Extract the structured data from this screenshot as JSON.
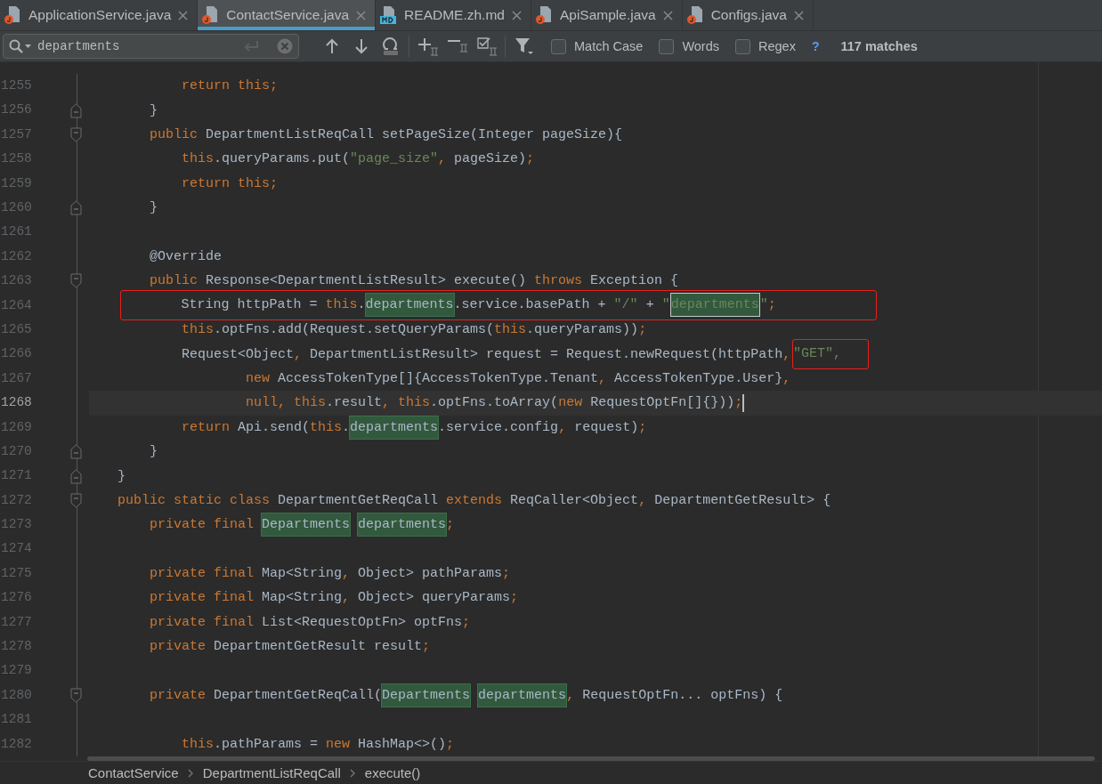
{
  "tabs": [
    {
      "label": "ApplicationService.java",
      "kind": "java",
      "selected": false
    },
    {
      "label": "ContactService.java",
      "kind": "java",
      "selected": true
    },
    {
      "label": "README.zh.md",
      "kind": "md",
      "selected": false
    },
    {
      "label": "ApiSample.java",
      "kind": "java",
      "selected": false
    },
    {
      "label": "Configs.java",
      "kind": "java",
      "selected": false
    }
  ],
  "search": {
    "value": "departments",
    "options": [
      {
        "label": "Match Case",
        "checked": false
      },
      {
        "label": "Words",
        "checked": false
      },
      {
        "label": "Regex",
        "checked": false
      }
    ],
    "help": "?",
    "matches": "117 matches"
  },
  "editor": {
    "lines": [
      {
        "number": "1255",
        "kind": "body",
        "current": false,
        "boxed": false,
        "fold_start": false,
        "fold_end": false,
        "tokens": [
          {
            "text": "return this;",
            "kind": "kw"
          }
        ]
      },
      {
        "number": "1256",
        "kind": "member",
        "current": false,
        "boxed": false,
        "fold_start": false,
        "fold_end": true,
        "tokens": [
          {
            "text": "}",
            "kind": "plain"
          }
        ]
      },
      {
        "number": "1257",
        "kind": "member",
        "current": false,
        "boxed": false,
        "fold_start": true,
        "fold_end": false,
        "tokens": [
          {
            "text": "public",
            "kind": "kw"
          },
          {
            "text": " DepartmentListReqCall setPageSize(Integer pageSize){",
            "kind": "plain"
          }
        ]
      },
      {
        "number": "1258",
        "kind": "body",
        "current": false,
        "boxed": false,
        "fold_start": false,
        "fold_end": false,
        "tokens": [
          {
            "text": "this",
            "kind": "kw"
          },
          {
            "text": ".queryParams.put(",
            "kind": "plain"
          },
          {
            "text": "\"page_size\"",
            "kind": "str"
          },
          {
            "text": ",",
            "kind": "kw"
          },
          {
            "text": " pageSize)",
            "kind": "plain"
          },
          {
            "text": ";",
            "kind": "kw"
          }
        ]
      },
      {
        "number": "1259",
        "kind": "body",
        "current": false,
        "boxed": false,
        "fold_start": false,
        "fold_end": false,
        "tokens": [
          {
            "text": "return this;",
            "kind": "kw"
          }
        ]
      },
      {
        "number": "1260",
        "kind": "member",
        "current": false,
        "boxed": false,
        "fold_start": false,
        "fold_end": true,
        "tokens": [
          {
            "text": "}",
            "kind": "plain"
          }
        ]
      },
      {
        "number": "1261",
        "kind": "member",
        "current": false,
        "boxed": false,
        "fold_start": false,
        "fold_end": false
      },
      {
        "number": "1262",
        "kind": "member",
        "current": false,
        "boxed": false,
        "fold_start": false,
        "fold_end": false,
        "tokens": [
          {
            "text": "@Override",
            "kind": "plain"
          }
        ]
      },
      {
        "number": "1263",
        "kind": "member",
        "current": false,
        "boxed": false,
        "fold_start": true,
        "fold_end": false,
        "tokens": [
          {
            "text": "public",
            "kind": "kw"
          },
          {
            "text": " Response<DepartmentListResult> execute() ",
            "kind": "plain"
          },
          {
            "text": "throws",
            "kind": "kw"
          },
          {
            "text": " Exception {",
            "kind": "plain"
          }
        ]
      },
      {
        "number": "1264",
        "kind": "body",
        "current": false,
        "boxed": true,
        "fold_start": false,
        "fold_end": false,
        "tokens": [
          {
            "text": "String httpPath = ",
            "kind": "plain"
          },
          {
            "text": "this",
            "kind": "kw"
          },
          {
            "text": ".",
            "kind": "plain"
          },
          {
            "text": "departments",
            "kind": "match"
          },
          {
            "text": ".service.basePath + ",
            "kind": "plain"
          },
          {
            "text": "\"/\"",
            "kind": "str"
          },
          {
            "text": " + ",
            "kind": "plain"
          },
          {
            "text": "\"",
            "kind": "str"
          },
          {
            "text": "departments",
            "kind": "current-match"
          },
          {
            "text": "\"",
            "kind": "str"
          },
          {
            "text": ";",
            "kind": "kw"
          }
        ]
      },
      {
        "number": "1265",
        "kind": "body",
        "current": false,
        "boxed": false,
        "fold_start": false,
        "fold_end": false,
        "tokens": [
          {
            "text": "this",
            "kind": "kw"
          },
          {
            "text": ".optFns.add(Request.setQueryParams(",
            "kind": "plain"
          },
          {
            "text": "this",
            "kind": "kw"
          },
          {
            "text": ".queryParams))",
            "kind": "plain"
          },
          {
            "text": ";",
            "kind": "kw"
          }
        ]
      },
      {
        "number": "1266",
        "kind": "body",
        "current": false,
        "boxed": false,
        "fold_start": false,
        "fold_end": false,
        "tokens": [
          {
            "text": "Request<Object",
            "kind": "plain"
          },
          {
            "text": ",",
            "kind": "kw"
          },
          {
            "text": " DepartmentListResult> request = Request.newRequest(httpPath",
            "kind": "plain"
          },
          {
            "text": ",",
            "kind": "kw"
          },
          {
            "text": "\"GET\",",
            "kind": "boxed-str"
          }
        ]
      },
      {
        "number": "1267",
        "kind": "continuation",
        "current": false,
        "boxed": false,
        "fold_start": false,
        "fold_end": false,
        "tokens": [
          {
            "text": "new",
            "kind": "kw"
          },
          {
            "text": " AccessTokenType[]{AccessTokenType.Tenant",
            "kind": "plain"
          },
          {
            "text": ",",
            "kind": "kw"
          },
          {
            "text": " AccessTokenType.User}",
            "kind": "plain"
          },
          {
            "text": ",",
            "kind": "kw"
          }
        ]
      },
      {
        "number": "1268",
        "kind": "continuation",
        "current": true,
        "boxed": false,
        "fold_start": false,
        "fold_end": false,
        "tokens": [
          {
            "text": "null,",
            "kind": "kw"
          },
          {
            "text": " this",
            "kind": "kw"
          },
          {
            "text": ".result",
            "kind": "plain"
          },
          {
            "text": ",",
            "kind": "kw"
          },
          {
            "text": " this",
            "kind": "kw"
          },
          {
            "text": ".optFns.toArray(",
            "kind": "plain"
          },
          {
            "text": "new",
            "kind": "kw"
          },
          {
            "text": " RequestOptFn[]{}))",
            "kind": "plain"
          },
          {
            "text": ";",
            "kind": "kw"
          }
        ]
      },
      {
        "number": "1269",
        "kind": "body",
        "current": false,
        "boxed": false,
        "fold_start": false,
        "fold_end": false,
        "tokens": [
          {
            "text": "return",
            "kind": "kw"
          },
          {
            "text": " Api.send(",
            "kind": "plain"
          },
          {
            "text": "this",
            "kind": "kw"
          },
          {
            "text": ".",
            "kind": "plain"
          },
          {
            "text": "departments",
            "kind": "match"
          },
          {
            "text": ".service.config",
            "kind": "plain"
          },
          {
            "text": ",",
            "kind": "kw"
          },
          {
            "text": " request)",
            "kind": "plain"
          },
          {
            "text": ";",
            "kind": "kw"
          }
        ]
      },
      {
        "number": "1270",
        "kind": "member",
        "current": false,
        "boxed": false,
        "fold_start": false,
        "fold_end": true,
        "tokens": [
          {
            "text": "}",
            "kind": "plain"
          }
        ]
      },
      {
        "number": "1271",
        "kind": "class",
        "current": false,
        "boxed": false,
        "fold_start": false,
        "fold_end": true,
        "tokens": [
          {
            "text": "}",
            "kind": "plain"
          }
        ]
      },
      {
        "number": "1272",
        "kind": "class",
        "current": false,
        "boxed": false,
        "fold_start": true,
        "fold_end": false,
        "tokens": [
          {
            "text": "public static class",
            "kind": "kw"
          },
          {
            "text": " DepartmentGetReqCall ",
            "kind": "plain"
          },
          {
            "text": "extends",
            "kind": "kw"
          },
          {
            "text": " ReqCaller<Object",
            "kind": "plain"
          },
          {
            "text": ",",
            "kind": "kw"
          },
          {
            "text": " DepartmentGetResult> {",
            "kind": "plain"
          }
        ]
      },
      {
        "number": "1273",
        "kind": "member",
        "current": false,
        "boxed": false,
        "fold_start": false,
        "fold_end": false,
        "tokens": [
          {
            "text": "private final ",
            "kind": "kw"
          },
          {
            "text": "Departments",
            "kind": "match"
          },
          {
            "text": "departments",
            "kind": "match"
          },
          {
            "text": ";",
            "kind": "kw"
          }
        ]
      },
      {
        "number": "1274",
        "kind": "member",
        "current": false,
        "boxed": false,
        "fold_start": false,
        "fold_end": false
      },
      {
        "number": "1275",
        "kind": "member",
        "current": false,
        "boxed": false,
        "fold_start": false,
        "fold_end": false,
        "tokens": [
          {
            "text": "private final",
            "kind": "kw"
          },
          {
            "text": " Map<String",
            "kind": "plain"
          },
          {
            "text": ",",
            "kind": "kw"
          },
          {
            "text": " Object> pathParams",
            "kind": "plain"
          },
          {
            "text": ";",
            "kind": "kw"
          }
        ]
      },
      {
        "number": "1276",
        "kind": "member",
        "current": false,
        "boxed": false,
        "fold_start": false,
        "fold_end": false,
        "tokens": [
          {
            "text": "private final",
            "kind": "kw"
          },
          {
            "text": " Map<String",
            "kind": "plain"
          },
          {
            "text": ",",
            "kind": "kw"
          },
          {
            "text": " Object> queryParams",
            "kind": "plain"
          },
          {
            "text": ";",
            "kind": "kw"
          }
        ]
      },
      {
        "number": "1277",
        "kind": "member",
        "current": false,
        "boxed": false,
        "fold_start": false,
        "fold_end": false,
        "tokens": [
          {
            "text": "private final",
            "kind": "kw"
          },
          {
            "text": " List<RequestOptFn> optFns",
            "kind": "plain"
          },
          {
            "text": ";",
            "kind": "kw"
          }
        ]
      },
      {
        "number": "1278",
        "kind": "member",
        "current": false,
        "boxed": false,
        "fold_start": false,
        "fold_end": false,
        "tokens": [
          {
            "text": "private",
            "kind": "kw"
          },
          {
            "text": " DepartmentGetResult result",
            "kind": "plain"
          },
          {
            "text": ";",
            "kind": "kw"
          }
        ]
      },
      {
        "number": "1279",
        "kind": "member",
        "current": false,
        "boxed": false,
        "fold_start": false,
        "fold_end": false
      },
      {
        "number": "1280",
        "kind": "member",
        "current": false,
        "boxed": false,
        "fold_start": true,
        "fold_end": false,
        "tokens": [
          {
            "text": "private",
            "kind": "kw"
          },
          {
            "text": " DepartmentGetReqCall(",
            "kind": "plain"
          },
          {
            "text": "Departments",
            "kind": "match"
          },
          {
            "text": "departments",
            "kind": "match"
          },
          {
            "text": ",",
            "kind": "kw"
          },
          {
            "text": " RequestOptFn... optFns) {",
            "kind": "plain"
          }
        ]
      },
      {
        "number": "1281",
        "kind": "member",
        "current": false,
        "boxed": false,
        "fold_start": false,
        "fold_end": false
      },
      {
        "number": "1282",
        "kind": "body",
        "current": false,
        "boxed": false,
        "fold_start": false,
        "fold_end": false,
        "tokens": [
          {
            "text": "this",
            "kind": "kw"
          },
          {
            "text": ".pathParams = ",
            "kind": "plain"
          },
          {
            "text": "new",
            "kind": "kw"
          },
          {
            "text": " HashMap<>()",
            "kind": "plain"
          },
          {
            "text": ";",
            "kind": "kw"
          }
        ]
      }
    ]
  },
  "breadcrumb": [
    "ContactService",
    "DepartmentListReqCall",
    "execute()"
  ]
}
